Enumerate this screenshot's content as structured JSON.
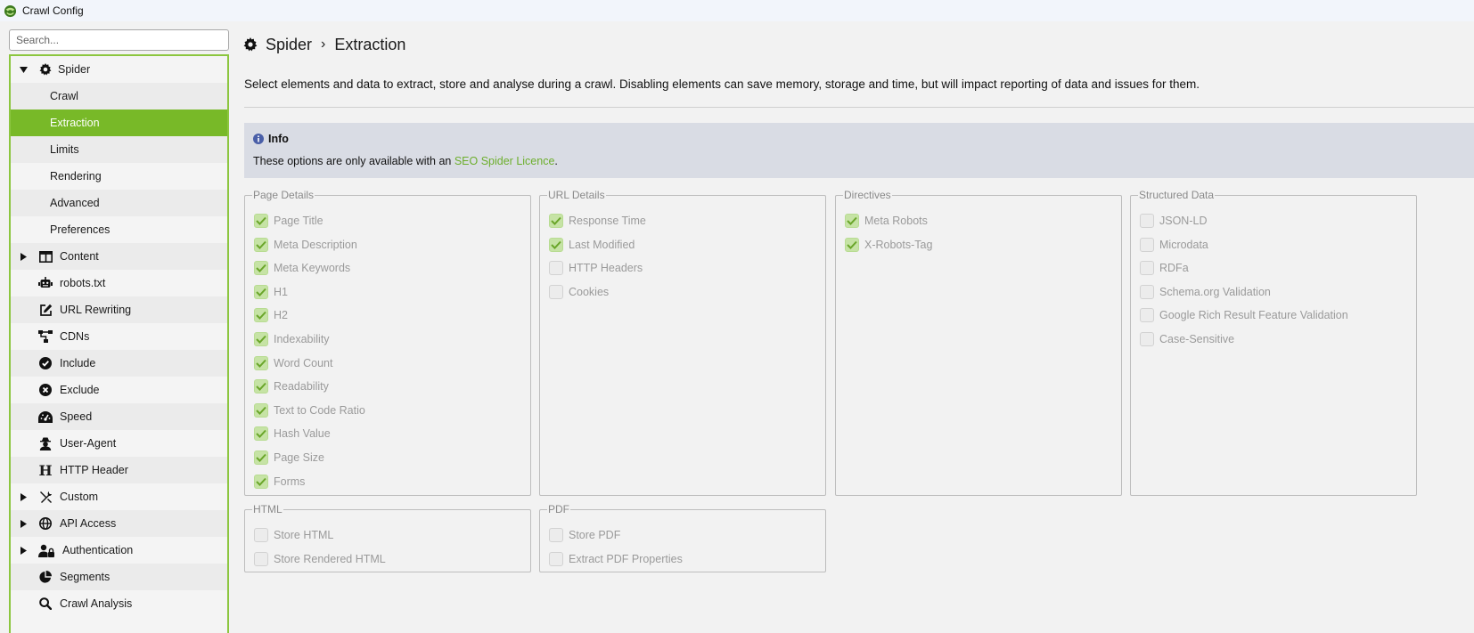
{
  "window": {
    "title": "Crawl Config"
  },
  "search": {
    "placeholder": "Search..."
  },
  "sidebar": {
    "items": [
      {
        "key": "spider",
        "label": "Spider",
        "icon": "gear-icon",
        "arrow": "expanded"
      },
      {
        "key": "crawl",
        "label": "Crawl",
        "child": true
      },
      {
        "key": "extraction",
        "label": "Extraction",
        "child": true,
        "selected": true
      },
      {
        "key": "limits",
        "label": "Limits",
        "child": true
      },
      {
        "key": "rendering",
        "label": "Rendering",
        "child": true
      },
      {
        "key": "advanced",
        "label": "Advanced",
        "child": true
      },
      {
        "key": "preferences",
        "label": "Preferences",
        "child": true
      },
      {
        "key": "content",
        "label": "Content",
        "icon": "columns-icon",
        "arrow": "collapsed"
      },
      {
        "key": "robots",
        "label": "robots.txt",
        "icon": "robot-icon"
      },
      {
        "key": "url-rewriting",
        "label": "URL Rewriting",
        "icon": "edit-icon"
      },
      {
        "key": "cdns",
        "label": "CDNs",
        "icon": "network-icon"
      },
      {
        "key": "include",
        "label": "Include",
        "icon": "check-circle-icon"
      },
      {
        "key": "exclude",
        "label": "Exclude",
        "icon": "x-circle-icon"
      },
      {
        "key": "speed",
        "label": "Speed",
        "icon": "speedometer-icon"
      },
      {
        "key": "user-agent",
        "label": "User-Agent",
        "icon": "user-secret-icon"
      },
      {
        "key": "http-header",
        "label": "HTTP Header",
        "icon": "h-icon"
      },
      {
        "key": "custom",
        "label": "Custom",
        "icon": "tools-icon",
        "arrow": "collapsed"
      },
      {
        "key": "api-access",
        "label": "API Access",
        "icon": "globe-icon",
        "arrow": "collapsed"
      },
      {
        "key": "authentication",
        "label": "Authentication",
        "icon": "user-lock-icon",
        "arrow": "collapsed"
      },
      {
        "key": "segments",
        "label": "Segments",
        "icon": "pie-icon"
      },
      {
        "key": "crawl-analysis",
        "label": "Crawl Analysis",
        "icon": "search-icon"
      }
    ]
  },
  "breadcrumb": {
    "parent": "Spider",
    "separator": "›",
    "current": "Extraction"
  },
  "description": "Select elements and data to extract, store and analyse during a crawl. Disabling elements can save memory, storage and time, but will impact reporting of data and issues for them.",
  "info": {
    "title": "Info",
    "text_before": "These options are only available with an ",
    "link": "SEO Spider Licence",
    "text_after": "."
  },
  "groups": [
    {
      "key": "page-details",
      "legend": "Page Details",
      "items": [
        {
          "label": "Page Title",
          "checked": true
        },
        {
          "label": "Meta Description",
          "checked": true
        },
        {
          "label": "Meta Keywords",
          "checked": true
        },
        {
          "label": "H1",
          "checked": true
        },
        {
          "label": "H2",
          "checked": true
        },
        {
          "label": "Indexability",
          "checked": true
        },
        {
          "label": "Word Count",
          "checked": true
        },
        {
          "label": "Readability",
          "checked": true
        },
        {
          "label": "Text to Code Ratio",
          "checked": true
        },
        {
          "label": "Hash Value",
          "checked": true
        },
        {
          "label": "Page Size",
          "checked": true
        },
        {
          "label": "Forms",
          "checked": true
        }
      ]
    },
    {
      "key": "url-details",
      "legend": "URL Details",
      "items": [
        {
          "label": "Response Time",
          "checked": true
        },
        {
          "label": "Last Modified",
          "checked": true
        },
        {
          "label": "HTTP Headers",
          "checked": false
        },
        {
          "label": "Cookies",
          "checked": false
        }
      ]
    },
    {
      "key": "directives",
      "legend": "Directives",
      "items": [
        {
          "label": "Meta Robots",
          "checked": true
        },
        {
          "label": "X-Robots-Tag",
          "checked": true
        }
      ]
    },
    {
      "key": "structured-data",
      "legend": "Structured Data",
      "items": [
        {
          "label": "JSON-LD",
          "checked": false
        },
        {
          "label": "Microdata",
          "checked": false
        },
        {
          "label": "RDFa",
          "checked": false
        },
        {
          "label": "Schema.org Validation",
          "checked": false
        },
        {
          "label": "Google Rich Result Feature Validation",
          "checked": false
        },
        {
          "label": "Case-Sensitive",
          "checked": false
        }
      ]
    },
    {
      "key": "html",
      "legend": "HTML",
      "items": [
        {
          "label": "Store HTML",
          "checked": false
        },
        {
          "label": "Store Rendered HTML",
          "checked": false
        }
      ]
    },
    {
      "key": "pdf",
      "legend": "PDF",
      "items": [
        {
          "label": "Store PDF",
          "checked": false
        },
        {
          "label": "Extract PDF Properties",
          "checked": false
        }
      ]
    }
  ],
  "colors": {
    "accent": "#78b928",
    "sidebar_border": "#8cc63f",
    "info_bg": "#d9dce4",
    "link": "#6cae2c",
    "checkbox_on": "#c6e3a5"
  }
}
